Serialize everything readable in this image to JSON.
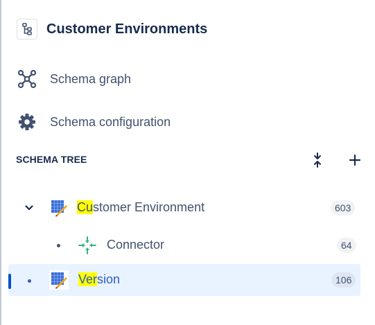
{
  "header": {
    "title": "Customer Environments",
    "icon": "tree-structure-icon"
  },
  "nav": [
    {
      "label": "Schema graph",
      "icon": "graph-icon"
    },
    {
      "label": "Schema configuration",
      "icon": "gear-icon"
    }
  ],
  "schema_tree": {
    "title": "SCHEMA TREE",
    "actions": [
      {
        "icon": "collapse-all-icon"
      },
      {
        "icon": "plus-icon"
      }
    ],
    "items": [
      {
        "label_highlight": "Cu",
        "label_rest": "stomer Environment",
        "count": "603",
        "icon": "object-type-icon",
        "expanded": true,
        "selected": false
      },
      {
        "label_highlight": "",
        "label_rest": "Connector",
        "count": "64",
        "icon": "connector-icon",
        "selected": false
      },
      {
        "label_highlight": "Ver",
        "label_rest": "sion",
        "count": "106",
        "icon": "object-type-icon",
        "selected": true
      }
    ]
  },
  "colors": {
    "accent": "#0052cc",
    "selected_bg": "#e9f2ff",
    "highlight": "#ffff00",
    "connector_green": "#36b37e"
  }
}
